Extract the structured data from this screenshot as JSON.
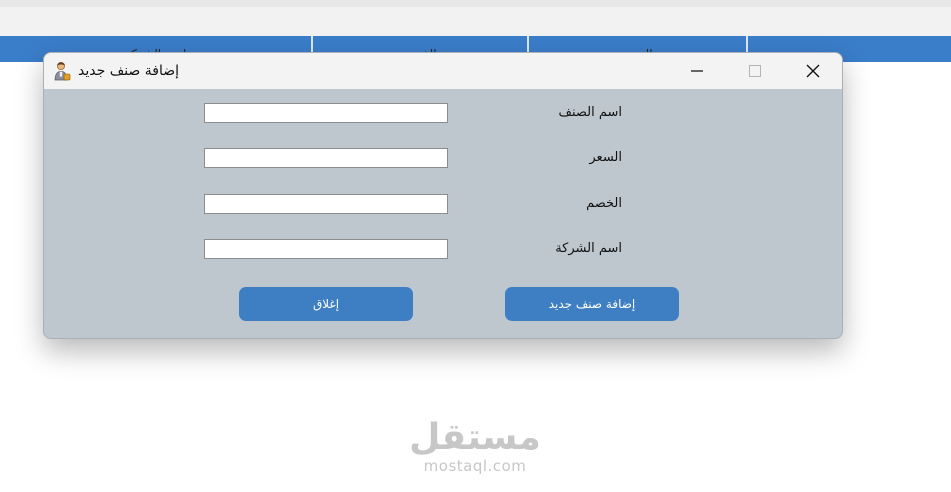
{
  "background_grid": {
    "columns": [
      "اسم الشركة",
      "الخصم",
      "السعر",
      ""
    ]
  },
  "dialog": {
    "title": "إضافة صنف جديد",
    "icon": "user-icon",
    "fields": [
      {
        "label": "اسم الصنف",
        "value": ""
      },
      {
        "label": "السعر",
        "value": ""
      },
      {
        "label": "الخصم",
        "value": ""
      },
      {
        "label": "اسم الشركة",
        "value": ""
      }
    ],
    "close_button": "إغلاق",
    "add_button": "إضافة صنف جديد"
  },
  "watermark": {
    "logo": "مستقل",
    "url": "mostaql.com"
  },
  "colors": {
    "accent": "#3e7fc3",
    "grid_header": "#3a7dc9",
    "dialog_body": "#bec6ce"
  }
}
